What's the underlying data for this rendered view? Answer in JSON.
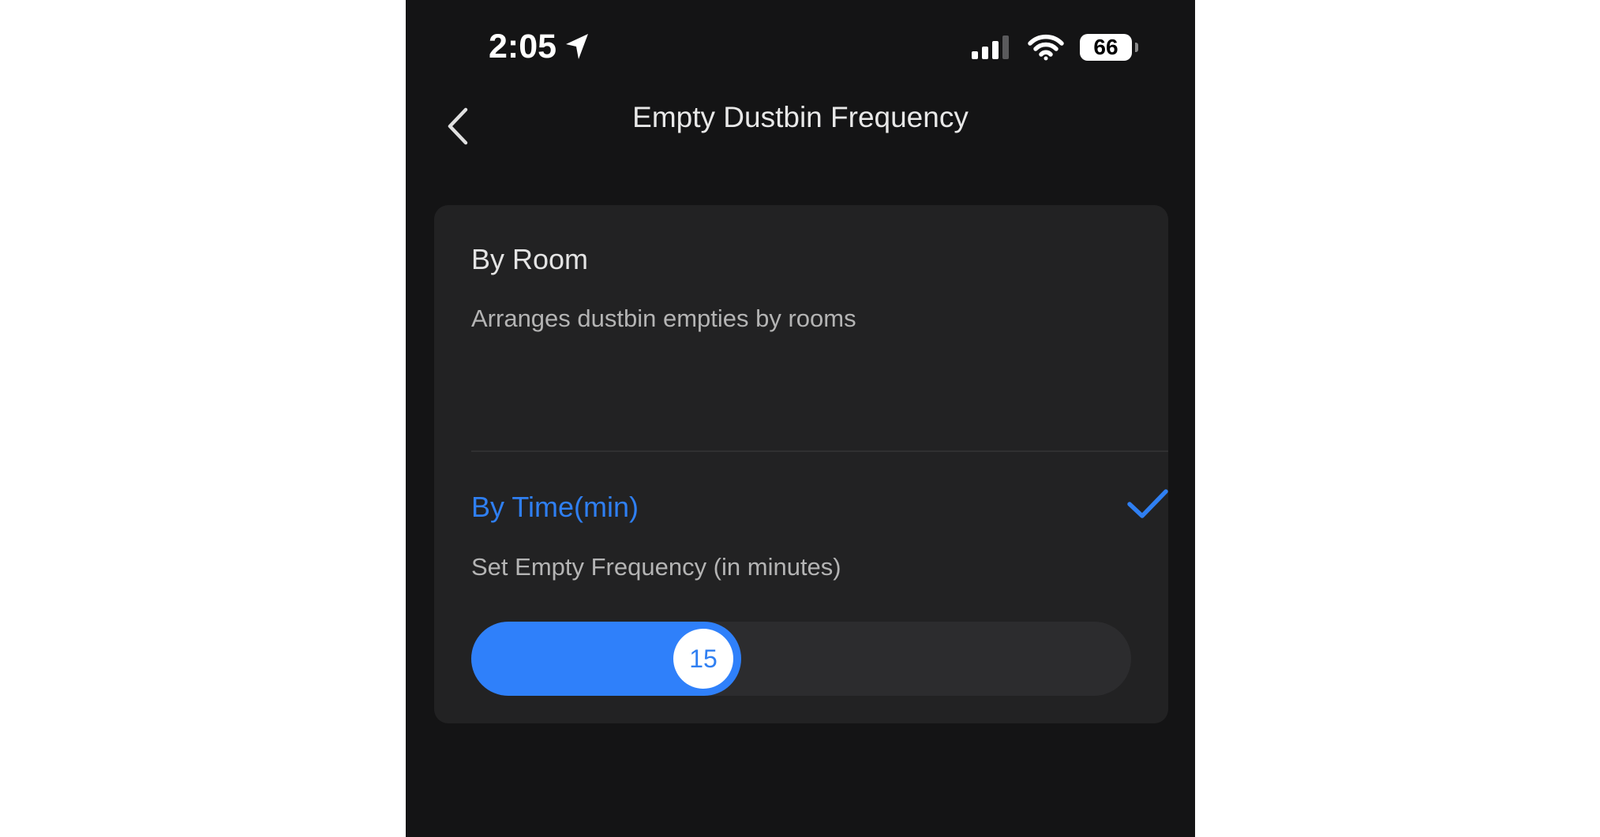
{
  "status_bar": {
    "time": "2:05",
    "battery": "66",
    "icons": [
      "location-arrow-icon",
      "cellular-signal-icon",
      "wifi-icon",
      "battery-icon"
    ]
  },
  "header": {
    "title": "Empty Dustbin Frequency",
    "back_icon": "chevron-left-icon"
  },
  "options": {
    "by_room": {
      "title": "By Room",
      "description": "Arranges dustbin empties by rooms",
      "selected": false
    },
    "by_time": {
      "title": "By Time(min)",
      "description": "Set  Empty Frequency (in minutes)",
      "selected": true,
      "check_icon": "checkmark-icon"
    }
  },
  "slider": {
    "value": "15"
  },
  "colors": {
    "background": "#141415",
    "card": "#222223",
    "accent": "#2f7ff2",
    "slider_fill": "#2f80fa"
  }
}
